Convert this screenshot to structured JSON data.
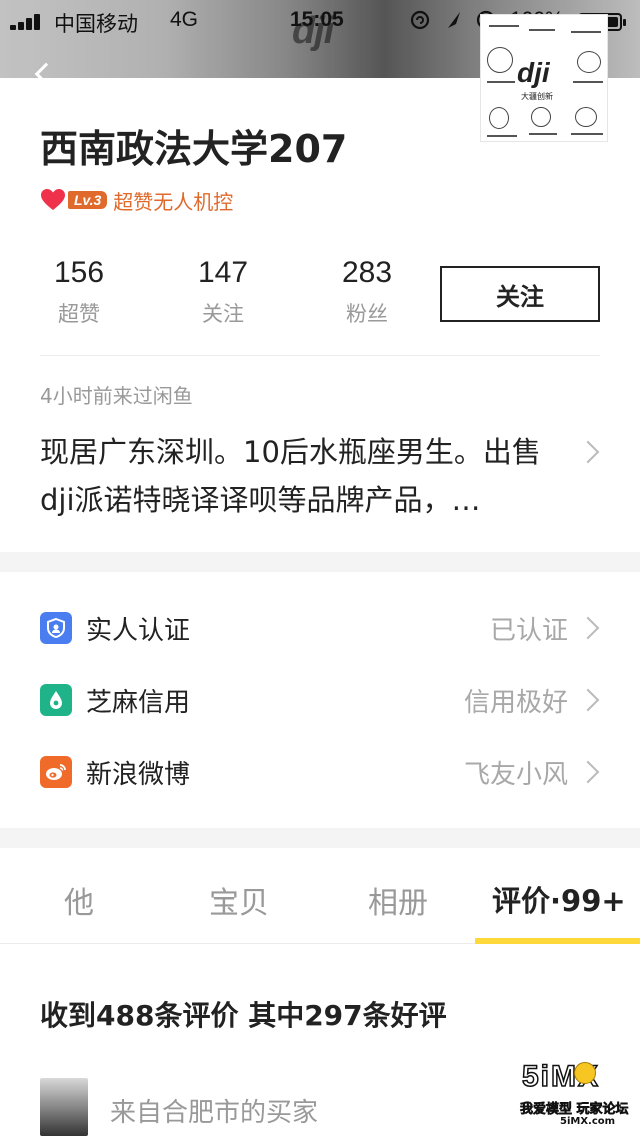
{
  "status_bar": {
    "carrier": "中国移动",
    "network": "4G",
    "time": "15:05",
    "battery": "100%"
  },
  "header": {
    "brand_logo": "dji"
  },
  "sticker": {
    "logo": "dji",
    "caption": "大疆创新"
  },
  "profile": {
    "name": "西南政法大学207",
    "level": "Lv.3",
    "level_title": "超赞无人机控",
    "stats": [
      {
        "value": "156",
        "label": "超赞"
      },
      {
        "value": "147",
        "label": "关注"
      },
      {
        "value": "283",
        "label": "粉丝"
      }
    ],
    "follow_label": "关注",
    "last_seen": "4小时前来过闲鱼",
    "bio": "现居广东深圳。10后水瓶座男生。出售dji派诺特晓译译呗等品牌产品，…"
  },
  "verifications": [
    {
      "label": "实人认证",
      "value": "已认证",
      "icon": "person-id-icon",
      "color": "#4a7ef0"
    },
    {
      "label": "芝麻信用",
      "value": "信用极好",
      "icon": "sesame-credit-icon",
      "color": "#1fb38a"
    },
    {
      "label": "新浪微博",
      "value": "飞友小风",
      "icon": "weibo-icon",
      "color": "#f06a2a"
    }
  ],
  "tabs": [
    {
      "label": "他"
    },
    {
      "label": "宝贝"
    },
    {
      "label": "相册"
    },
    {
      "label": "评价·99+",
      "active": true
    }
  ],
  "reviews": {
    "summary": "收到488条评价 其中297条好评",
    "first_from": "来自合肥市的买家"
  },
  "watermark": {
    "logo": "5iMX",
    "subtitle": "我爱模型 玩家论坛",
    "url": "5iMX.com"
  },
  "colors": {
    "accent_orange": "#e06a2c",
    "tab_indicator": "#ffd83a"
  }
}
